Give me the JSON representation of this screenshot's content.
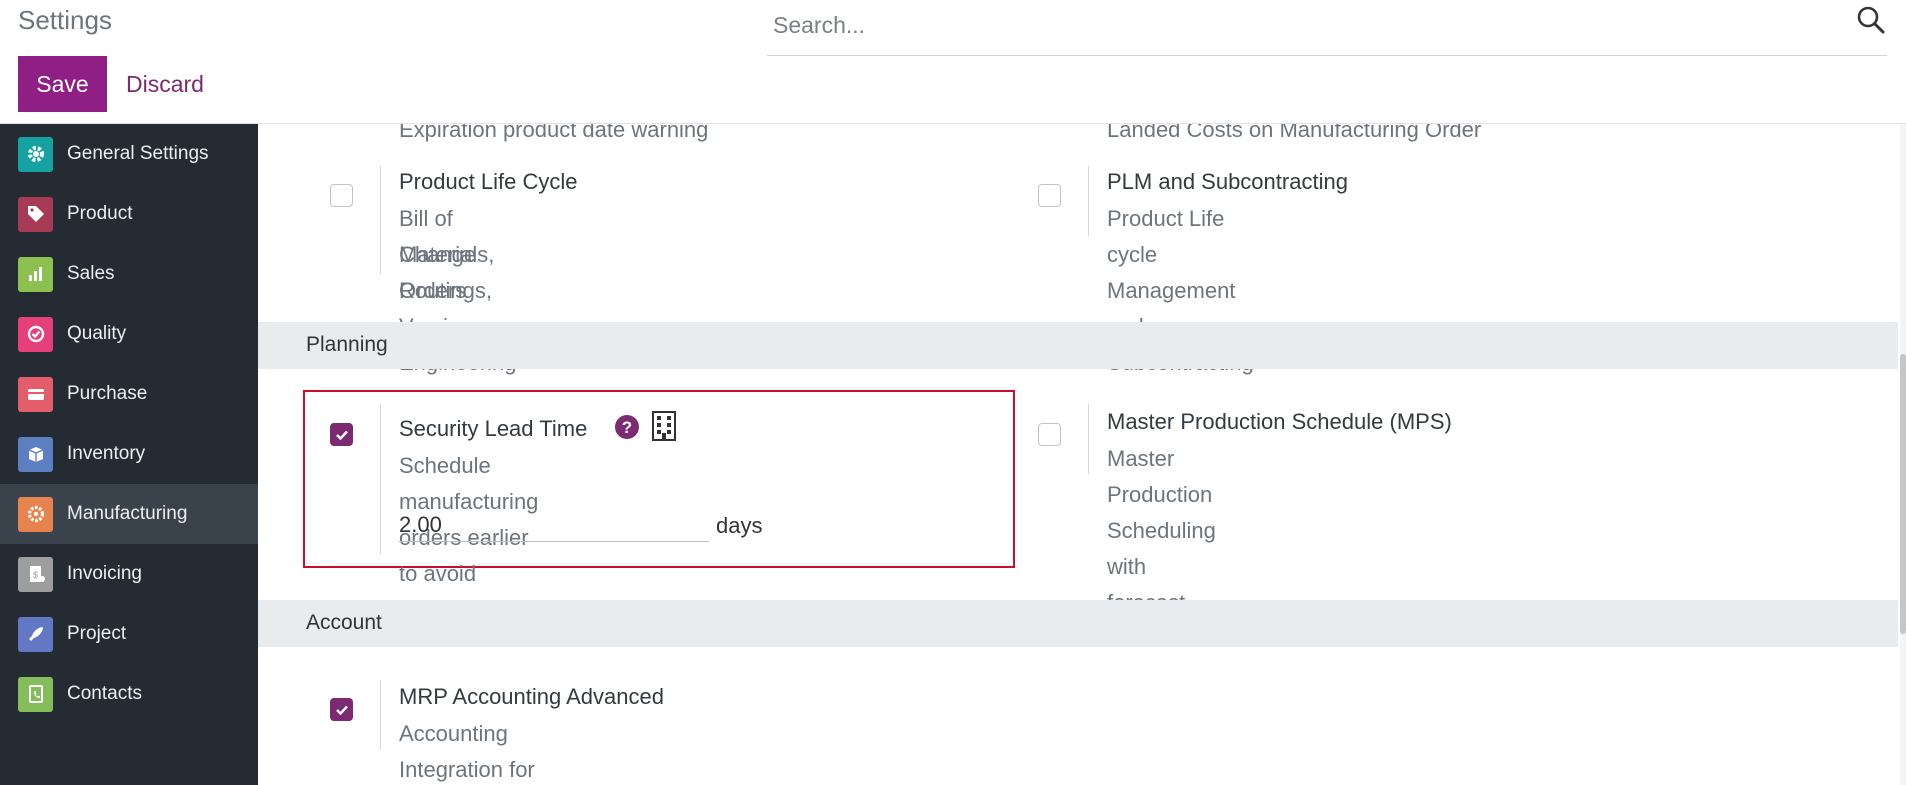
{
  "header": {
    "breadcrumb": "Settings",
    "search_placeholder": "Search...",
    "save_label": "Save",
    "discard_label": "Discard"
  },
  "sidebar": {
    "items": [
      {
        "label": "General Settings",
        "icon": "gear-icon",
        "color": "#17a2a2"
      },
      {
        "label": "Product",
        "icon": "tags-icon",
        "color": "#a73b55"
      },
      {
        "label": "Sales",
        "icon": "chart-icon",
        "color": "#8cc152"
      },
      {
        "label": "Quality",
        "icon": "check-circle-icon",
        "color": "#e6407a"
      },
      {
        "label": "Purchase",
        "icon": "credit-card-icon",
        "color": "#e45d6a"
      },
      {
        "label": "Inventory",
        "icon": "box-icon",
        "color": "#5c7fc2"
      },
      {
        "label": "Manufacturing",
        "icon": "cog-icon",
        "color": "#e7834e"
      },
      {
        "label": "Invoicing",
        "icon": "invoice-icon",
        "color": "#9e9e9e"
      },
      {
        "label": "Project",
        "icon": "rocket-icon",
        "color": "#6378c5"
      },
      {
        "label": "Contacts",
        "icon": "phone-book-icon",
        "color": "#84bd59"
      }
    ],
    "active_index": 6
  },
  "main": {
    "partial_top_left": "Expiration product date warning",
    "partial_top_right": "Landed Costs on Manufacturing Order",
    "plm": {
      "title": "Product Life Cycle",
      "desc_line1": "Bill of Materials, Routings, Versions, Engineering",
      "desc_line2": "Change Orders",
      "checked": false
    },
    "plm_sub": {
      "title": "PLM and Subcontracting",
      "desc": "Product Life cycle Management and Subcontracting",
      "checked": false
    },
    "planning_section": "Planning",
    "security_lead": {
      "title": "Security Lead Time",
      "desc": "Schedule manufacturing orders earlier to avoid delays",
      "value": "2.00",
      "unit": "days",
      "checked": true
    },
    "mps": {
      "title": "Master Production Schedule (MPS)",
      "desc": "Master Production Scheduling with forecast",
      "checked": false
    },
    "account_section": "Account",
    "mrp_accounting": {
      "title": "MRP Accounting Advanced",
      "desc": "Accounting Integration for Manufacturing",
      "checked": true
    }
  },
  "colors": {
    "brand": "#7c2a72",
    "save_button": "#8f1e85",
    "sidebar_bg": "#242b32",
    "highlight": "#c8102e"
  }
}
